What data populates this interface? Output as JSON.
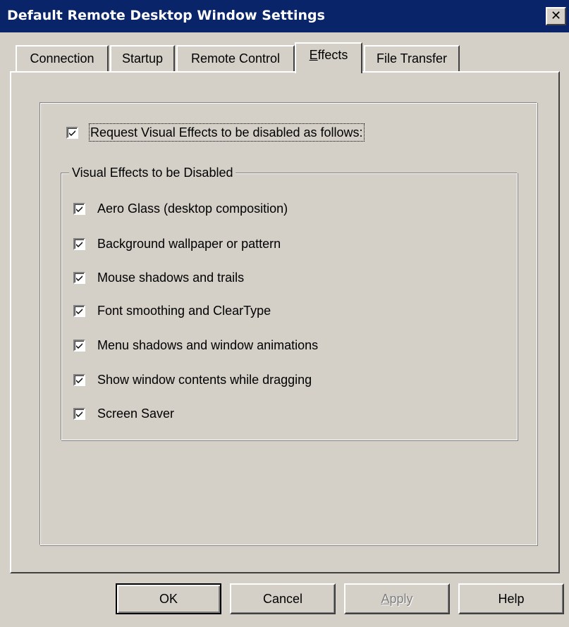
{
  "window": {
    "title": "Default Remote Desktop Window Settings",
    "close_glyph": "✕"
  },
  "tabs": [
    {
      "label": "Connection",
      "active": false
    },
    {
      "label": "Startup",
      "active": false
    },
    {
      "label": "Remote Control",
      "active": false
    },
    {
      "label_pre": "",
      "label_accel": "E",
      "label_post": "ffects",
      "label": "Effects",
      "active": true
    },
    {
      "label": "File Transfer",
      "active": false
    }
  ],
  "effects": {
    "request_checkbox": {
      "label": "Request Visual Effects to be disabled as follows:",
      "checked": true
    },
    "group_label": "Visual Effects to be Disabled",
    "items": [
      {
        "label": "Aero Glass (desktop composition)",
        "checked": true
      },
      {
        "label": "Background wallpaper or pattern",
        "checked": true
      },
      {
        "label": "Mouse shadows and trails",
        "checked": true
      },
      {
        "label": "Font smoothing and ClearType",
        "checked": true
      },
      {
        "label": "Menu shadows and window animations",
        "checked": true
      },
      {
        "label": "Show window contents while dragging",
        "checked": true
      },
      {
        "label": "Screen Saver",
        "checked": true
      }
    ]
  },
  "buttons": {
    "ok": "OK",
    "cancel": "Cancel",
    "apply_accel": "A",
    "apply_rest": "pply",
    "help": "Help"
  },
  "colors": {
    "face": "#d4d0c8",
    "titlebar": "#0a246a",
    "disabled_text": "#808080"
  }
}
